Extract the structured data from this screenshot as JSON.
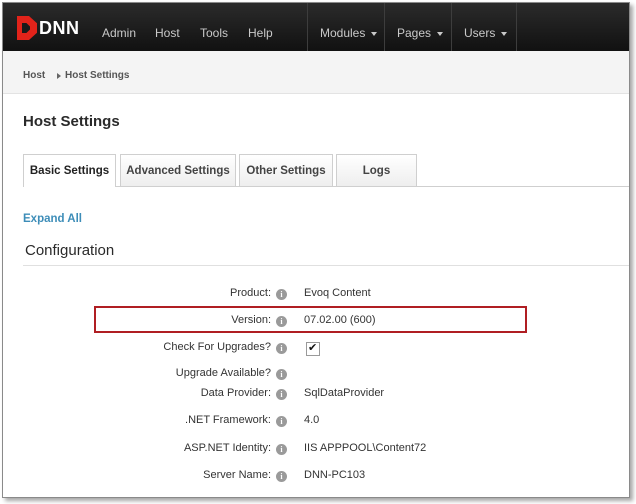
{
  "nav": {
    "logo_text": "DNN",
    "left_items": [
      "Admin",
      "Host",
      "Tools",
      "Help"
    ],
    "right_items": [
      "Modules",
      "Pages",
      "Users"
    ]
  },
  "breadcrumb": {
    "root": "Host",
    "current": "Host Settings"
  },
  "page": {
    "title": "Host Settings"
  },
  "tabs": [
    {
      "label": "Basic Settings",
      "active": true
    },
    {
      "label": "Advanced Settings",
      "active": false
    },
    {
      "label": "Other Settings",
      "active": false
    },
    {
      "label": "Logs",
      "active": false
    }
  ],
  "expand_all": "Expand All",
  "section": {
    "title": "Configuration"
  },
  "fields": [
    {
      "label": "Product:",
      "value": "Evoq Content"
    },
    {
      "label": "Version:",
      "value": "07.02.00 (600)"
    },
    {
      "label": "Check For Upgrades?",
      "checked": true
    },
    {
      "label": "Upgrade Available?",
      "value": ""
    },
    {
      "label": "Data Provider:",
      "value": "SqlDataProvider"
    },
    {
      "label": ".NET Framework:",
      "value": "4.0"
    },
    {
      "label": "ASP.NET Identity:",
      "value": "IIS APPPOOL\\Content72"
    },
    {
      "label": "Server Name:",
      "value": "DNN-PC103"
    }
  ],
  "info_icon_glyph": "i",
  "check_glyph": "✔",
  "colors": {
    "highlight_border": "#b01e23",
    "link": "#3d8db8",
    "logo_red": "#e2231a"
  }
}
